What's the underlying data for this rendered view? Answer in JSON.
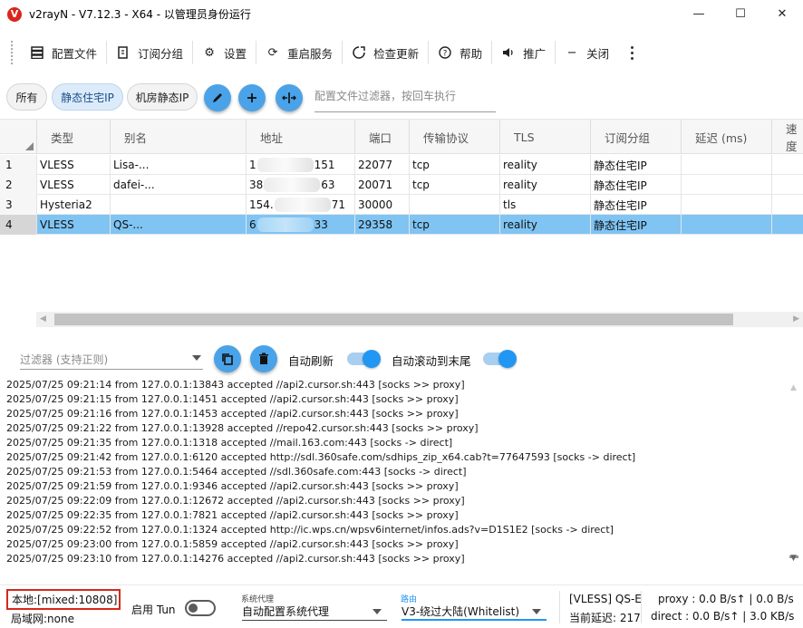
{
  "window": {
    "title": "v2rayN - V7.12.3 - X64 - 以管理员身份运行",
    "logo_letter": "V",
    "minimize": "—",
    "maximize": "☐",
    "close": "✕"
  },
  "toolbar": {
    "items": [
      {
        "label": "配置文件",
        "icon": "server-icon"
      },
      {
        "label": "订阅分组",
        "icon": "subscription-icon"
      },
      {
        "label": "设置",
        "icon": "gear-icon"
      },
      {
        "label": "重启服务",
        "icon": "restart-icon"
      },
      {
        "label": "检查更新",
        "icon": "update-icon"
      },
      {
        "label": "帮助",
        "icon": "help-icon"
      },
      {
        "label": "推广",
        "icon": "speaker-icon"
      },
      {
        "label": "关闭",
        "icon": "minus-icon"
      }
    ]
  },
  "groups": {
    "chips": [
      "所有",
      "静态住宅IP",
      "机房静态IP"
    ],
    "active_index": 1,
    "filter_placeholder": "配置文件过滤器，按回车执行"
  },
  "table": {
    "columns": [
      "类型",
      "别名",
      "地址",
      "端口",
      "传输协议",
      "TLS",
      "订阅分组",
      "延迟 (ms)",
      "速度"
    ],
    "rows": [
      {
        "idx": "1",
        "type": "VLESS",
        "alias": "Lisa-...",
        "addr_a": "1",
        "addr_b": "151",
        "port": "22077",
        "network": "tcp",
        "tls": "reality",
        "group": "静态住宅IP",
        "delay": "",
        "speed": ""
      },
      {
        "idx": "2",
        "type": "VLESS",
        "alias": "dafei-...",
        "addr_a": "38",
        "addr_b": "63",
        "port": "20071",
        "network": "tcp",
        "tls": "reality",
        "group": "静态住宅IP",
        "delay": "",
        "speed": ""
      },
      {
        "idx": "3",
        "type": "Hysteria2",
        "alias": "",
        "addr_a": "154.",
        "addr_b": "71",
        "port": "30000",
        "network": "",
        "tls": "tls",
        "group": "静态住宅IP",
        "delay": "",
        "speed": ""
      },
      {
        "idx": "4",
        "type": "VLESS",
        "alias": "QS-...",
        "addr_a": "6",
        "addr_b": "33",
        "port": "29358",
        "network": "tcp",
        "tls": "reality",
        "group": "静态住宅IP",
        "delay": "",
        "speed": ""
      }
    ],
    "selected_index": 3
  },
  "log": {
    "filter_placeholder": "过滤器 (支持正则)",
    "auto_refresh_label": "自动刷新",
    "auto_scroll_label": "自动滚动到末尾",
    "auto_refresh": true,
    "auto_scroll": true,
    "lines": [
      "2025/07/25 09:21:14 from 127.0.0.1:13843 accepted //api2.cursor.sh:443 [socks >> proxy]",
      "2025/07/25 09:21:15 from 127.0.0.1:1451 accepted //api2.cursor.sh:443 [socks >> proxy]",
      "2025/07/25 09:21:16 from 127.0.0.1:1453 accepted //api2.cursor.sh:443 [socks >> proxy]",
      "2025/07/25 09:21:22 from 127.0.0.1:13928 accepted //repo42.cursor.sh:443 [socks >> proxy]",
      "2025/07/25 09:21:35 from 127.0.0.1:1318 accepted //mail.163.com:443 [socks -> direct]",
      "2025/07/25 09:21:42 from 127.0.0.1:6120 accepted http://sdl.360safe.com/sdhips_zip_x64.cab?t=77647593 [socks -> direct]",
      "2025/07/25 09:21:53 from 127.0.0.1:5464 accepted //sdl.360safe.com:443 [socks -> direct]",
      "2025/07/25 09:21:59 from 127.0.0.1:9346 accepted //api2.cursor.sh:443 [socks >> proxy]",
      "2025/07/25 09:22:09 from 127.0.0.1:12672 accepted //api2.cursor.sh:443 [socks >> proxy]",
      "2025/07/25 09:22:35 from 127.0.0.1:7821 accepted //api2.cursor.sh:443 [socks >> proxy]",
      "2025/07/25 09:22:52 from 127.0.0.1:1324 accepted http://ic.wps.cn/wpsv6internet/infos.ads?v=D1S1E2 [socks -> direct]",
      "2025/07/25 09:23:00 from 127.0.0.1:5859 accepted //api2.cursor.sh:443 [socks >> proxy]",
      "2025/07/25 09:23:10 from 127.0.0.1:14276 accepted //api2.cursor.sh:443 [socks >> proxy]"
    ]
  },
  "status": {
    "local": "本地:[mixed:10808]",
    "lan": "局域网:none",
    "tun_label": "启用 Tun",
    "tun_enabled": false,
    "sysproxy_caption": "系统代理",
    "sysproxy_value": "自动配置系统代理",
    "routing_caption": "路由",
    "routing_value": "V3-绕过大陆(Whitelist)",
    "current_server": "[VLESS] QS-E",
    "current_delay": "当前延迟: 217",
    "proxy_speed": "proxy : 0.0 B/s↑ | 0.0 B/s",
    "direct_speed": "direct : 0.0 B/s↑ | 3.0 KB/s"
  },
  "colors": {
    "accent": "#2196f3",
    "selected_row": "#7fc4f3",
    "highlight_border": "#d9261c",
    "logo": "#d9261c"
  }
}
